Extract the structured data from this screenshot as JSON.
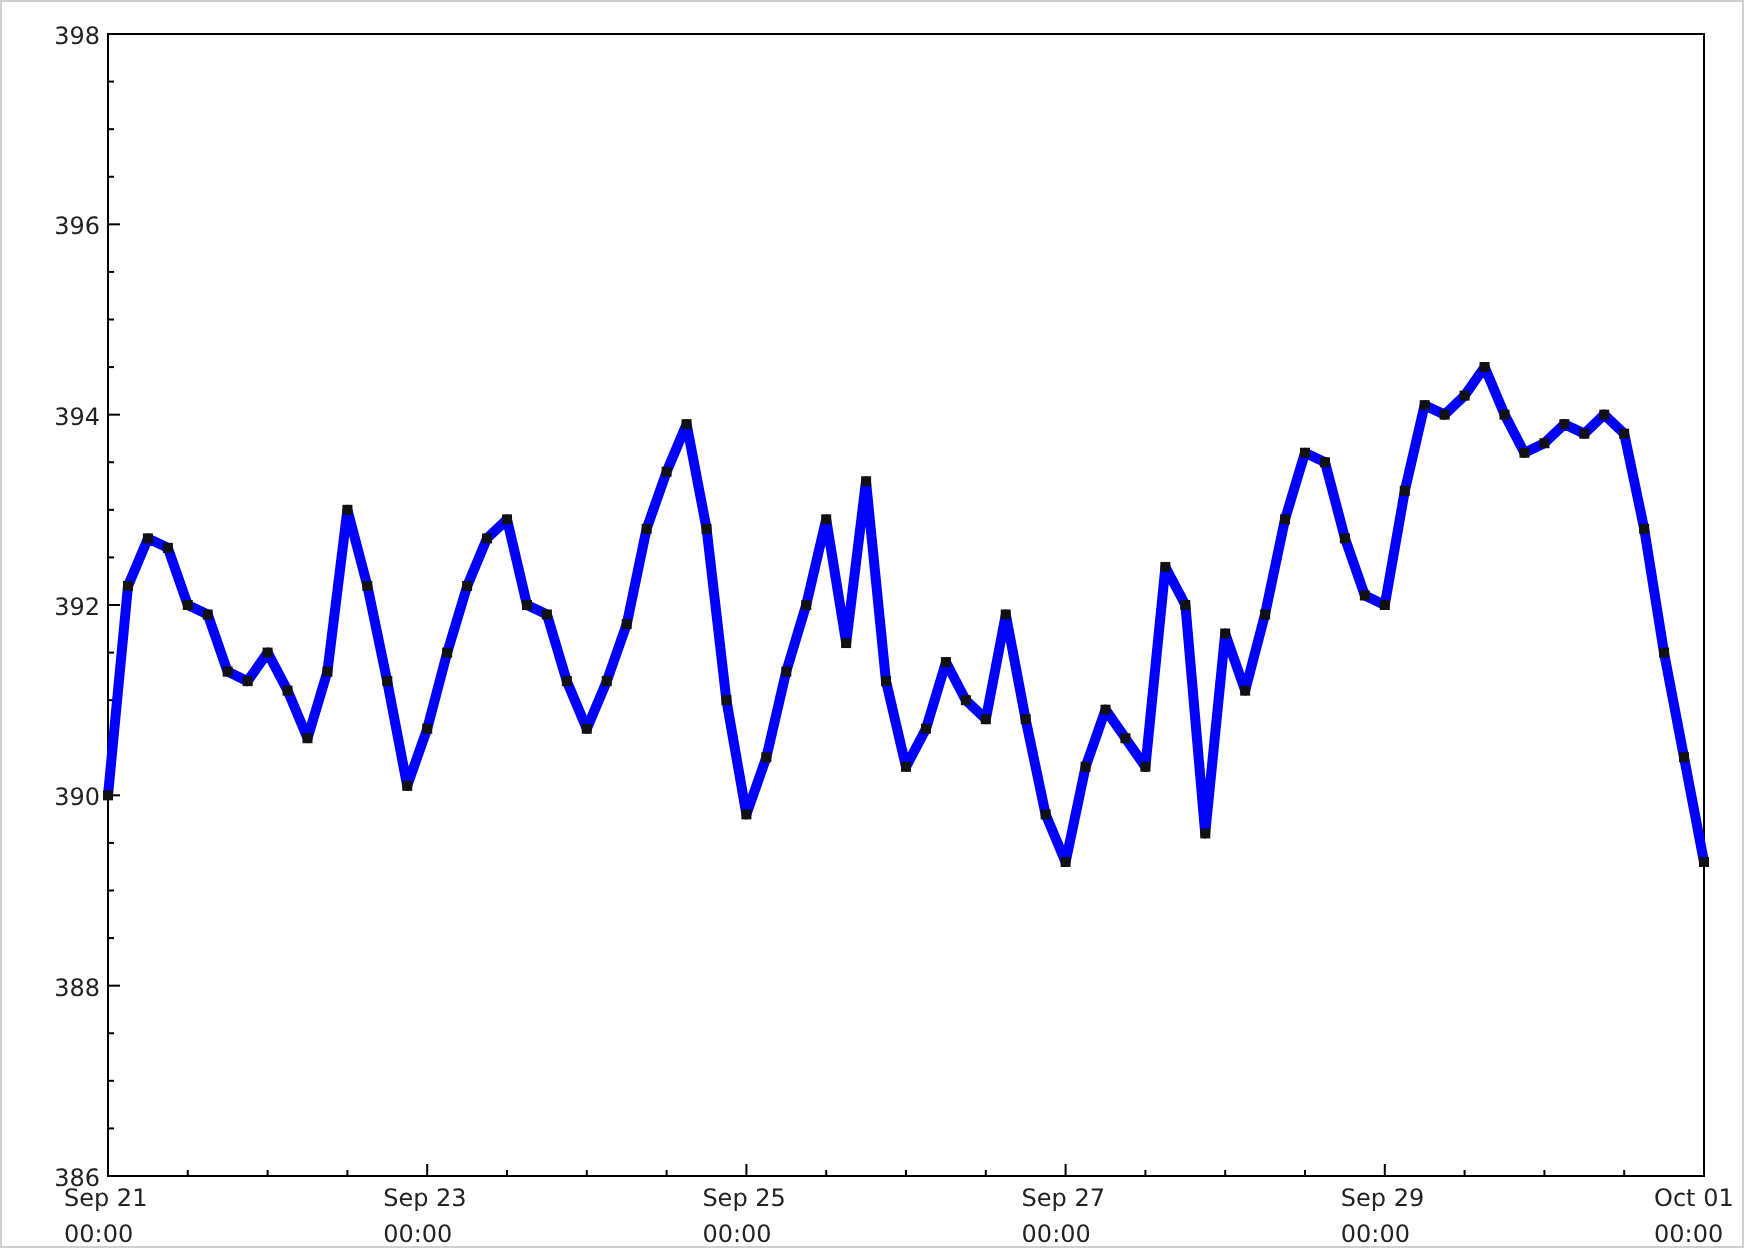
{
  "chart_data": {
    "type": "line",
    "categories": [
      "Sep 21\n00:00",
      null,
      null,
      null,
      null,
      null,
      null,
      null,
      null,
      null,
      null,
      null,
      null,
      null,
      null,
      null,
      "Sep 23\n00:00",
      null,
      null,
      null,
      null,
      null,
      null,
      null,
      null,
      null,
      null,
      null,
      null,
      null,
      null,
      null,
      "Sep 25\n00:00",
      null,
      null,
      null,
      null,
      null,
      null,
      null,
      null,
      null,
      null,
      null,
      null,
      null,
      null,
      null,
      "Sep 27\n00:00",
      null,
      null,
      null,
      null,
      null,
      null,
      null,
      null,
      null,
      null,
      null,
      null,
      null,
      null,
      null,
      "Sep 29\n00:00",
      null,
      null,
      null,
      null,
      null,
      null,
      null,
      null,
      null,
      null,
      null,
      null,
      null,
      null,
      null,
      "Oct 01\n00:00"
    ],
    "series": [
      {
        "color": "#0000ff",
        "marker": "square",
        "values": [
          390,
          392.2,
          392.7,
          392.6,
          392,
          391.9,
          391.3,
          391.2,
          391.5,
          391.1,
          390.6,
          391.3,
          393,
          392.2,
          391.2,
          390.1,
          390.7,
          391.5,
          392.2,
          392.7,
          392.9,
          392,
          391.9,
          391.2,
          390.7,
          391.2,
          391.8,
          392.8,
          393.4,
          393.9,
          392.8,
          391,
          389.8,
          390.4,
          391.3,
          392,
          392.9,
          391.6,
          393.3,
          391.2,
          390.3,
          390.7,
          391.4,
          391,
          390.8,
          391.9,
          390.8,
          389.8,
          389.3,
          390.3,
          390.9,
          390.6,
          390.3,
          392.4,
          392,
          389.6,
          391.7,
          391.1,
          391.9,
          392.9,
          393.6,
          393.5,
          392.7,
          392.1,
          392,
          393.2,
          394.1,
          394,
          394.2,
          394.5,
          394,
          393.6,
          393.7,
          393.9,
          393.8,
          394,
          393.8,
          392.8,
          391.5,
          390.4,
          389.3
        ]
      }
    ],
    "ylim": [
      386,
      398
    ],
    "yticks": [
      386,
      388,
      390,
      392,
      394,
      396,
      398
    ]
  }
}
